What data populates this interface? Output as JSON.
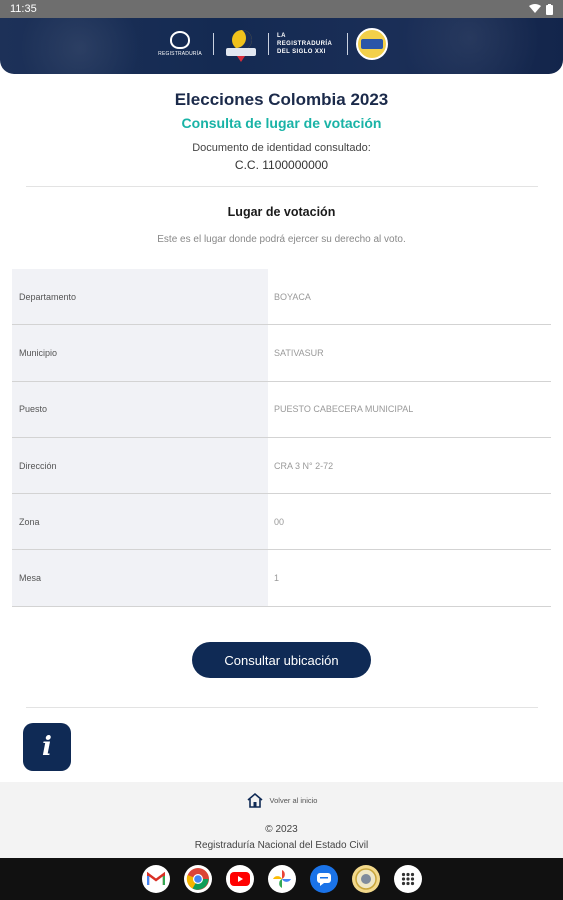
{
  "status_bar": {
    "time": "11:35"
  },
  "header": {
    "logo_text_line1": "LA REGISTRADURÍA",
    "logo_text_line2": "DEL SIGLO XXI"
  },
  "page": {
    "title": "Elecciones Colombia 2023",
    "subtitle": "Consulta de lugar de votación",
    "doc_label": "Documento de identidad consultado:",
    "doc_value": "C.C. 1100000000"
  },
  "section": {
    "title": "Lugar de votación",
    "description": "Este es el lugar donde podrá ejercer su derecho al voto."
  },
  "table": {
    "rows": [
      {
        "label": "Departamento",
        "value": "BOYACA"
      },
      {
        "label": "Municipio",
        "value": "SATIVASUR"
      },
      {
        "label": "Puesto",
        "value": "PUESTO CABECERA MUNICIPAL"
      },
      {
        "label": "Dirección",
        "value": "CRA 3 N° 2-72"
      },
      {
        "label": "Zona",
        "value": "00"
      },
      {
        "label": "Mesa",
        "value": "1"
      }
    ]
  },
  "actions": {
    "consultar_label": "Consultar ubicación",
    "info_glyph": "i"
  },
  "footer": {
    "home_label": "Volver al inicio",
    "copyright": "© 2023",
    "organization": "Registraduría Nacional del Estado Civil"
  },
  "taskbar": {
    "apps": [
      "gmail-icon",
      "chrome-icon",
      "youtube-icon",
      "photos-icon",
      "messages-icon",
      "registraduria-app-icon",
      "app-drawer-icon"
    ]
  },
  "colors": {
    "navy": "#0f2a55",
    "teal": "#19b3a6",
    "label_bg": "#f1f2f6"
  }
}
